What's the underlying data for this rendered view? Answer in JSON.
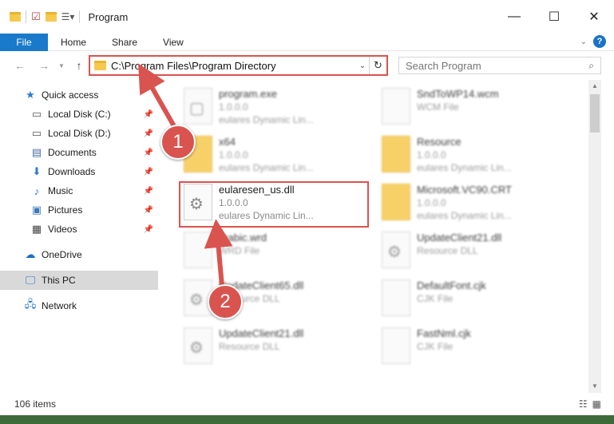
{
  "window": {
    "title": "Program",
    "controls": {
      "minimize": "—",
      "maximize": "☐",
      "close": "✕"
    }
  },
  "ribbon": {
    "file_tab": "File",
    "tabs": [
      "Home",
      "Share",
      "View"
    ]
  },
  "address_bar": {
    "path": "C:\\Program Files\\Program Directory"
  },
  "search": {
    "placeholder": "Search Program"
  },
  "sidebar": {
    "quick_access": "Quick access",
    "items": [
      {
        "label": "Local Disk (C:)",
        "icon": "drive-icon",
        "pinned": true
      },
      {
        "label": "Local Disk (D:)",
        "icon": "drive-icon",
        "pinned": true
      },
      {
        "label": "Documents",
        "icon": "documents-icon",
        "pinned": true
      },
      {
        "label": "Downloads",
        "icon": "download-icon",
        "pinned": true
      },
      {
        "label": "Music",
        "icon": "music-icon",
        "pinned": true
      },
      {
        "label": "Pictures",
        "icon": "pictures-icon",
        "pinned": true
      },
      {
        "label": "Videos",
        "icon": "videos-icon",
        "pinned": true
      }
    ],
    "onedrive": "OneDrive",
    "this_pc": "This PC",
    "network": "Network"
  },
  "files": [
    {
      "name": "program.exe",
      "line2": "1.0.0.0",
      "line3": "eulares Dynamic Lin...",
      "kind": "exe",
      "blurred": true
    },
    {
      "name": "SndToWP14.wcm",
      "line2": "WCM File",
      "line3": "",
      "kind": "doc",
      "blurred": true
    },
    {
      "name": "x64",
      "line2": "1.0.0.0",
      "line3": "eulares Dynamic Lin...",
      "kind": "folder",
      "blurred": true
    },
    {
      "name": "Resource",
      "line2": "1.0.0.0",
      "line3": "eulares Dynamic Lin...",
      "kind": "folder",
      "blurred": true
    },
    {
      "name": "eularesen_us.dll",
      "line2": "1.0.0.0",
      "line3": "eulares Dynamic Lin...",
      "kind": "dll",
      "blurred": false
    },
    {
      "name": "Microsoft.VC90.CRT",
      "line2": "1.0.0.0",
      "line3": "eulares Dynamic Lin...",
      "kind": "folder",
      "blurred": true
    },
    {
      "name": "arabic.wrd",
      "line2": "WRD File",
      "line3": "",
      "kind": "doc",
      "blurred": true
    },
    {
      "name": "UpdateClient21.dll",
      "line2": "Resource DLL",
      "line3": "",
      "kind": "dll",
      "blurred": true
    },
    {
      "name": "UpdateClient65.dll",
      "line2": "Resource DLL",
      "line3": "",
      "kind": "dll",
      "blurred": true
    },
    {
      "name": "DefaultFont.cjk",
      "line2": "CJK File",
      "line3": "",
      "kind": "doc",
      "blurred": true
    },
    {
      "name": "UpdateClient21.dll",
      "line2": "Resource DLL",
      "line3": "",
      "kind": "dll",
      "blurred": true
    },
    {
      "name": "FastNml.cjk",
      "line2": "CJK File",
      "line3": "",
      "kind": "doc",
      "blurred": true
    }
  ],
  "status": {
    "item_count": "106 items"
  },
  "annotations": {
    "badge1": "1",
    "badge2": "2"
  },
  "colors": {
    "accent": "#1979ca",
    "highlight": "#d9534f"
  }
}
